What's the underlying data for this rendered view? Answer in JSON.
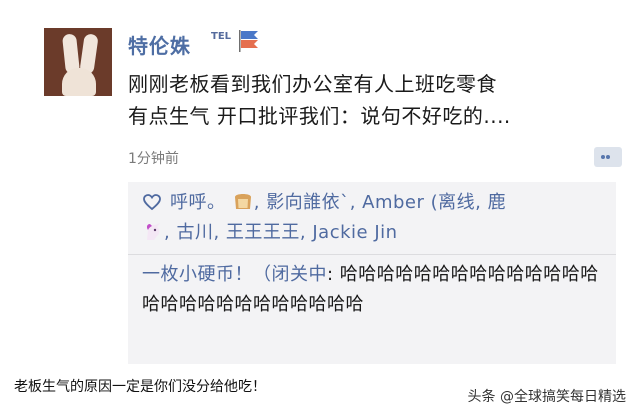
{
  "post": {
    "username": "特伦姝",
    "badge": "TEL",
    "text_line1": "刚刚老板看到我们办公室有人上班吃零食",
    "text_line2": "有点生气 开口批评我们：说句不好吃的....",
    "timestamp": "1分钟前"
  },
  "likes": {
    "names": [
      "呼呼。",
      "影向誰依`",
      "Amber (离线",
      "鹿",
      "古川",
      "王王王王",
      "Jackie Jin"
    ],
    "separator": ", "
  },
  "comment": {
    "author": "一枚小硬币！（闭关中",
    "colon": ": ",
    "text": "哈哈哈哈哈哈哈哈哈哈哈哈哈哈哈哈哈哈哈哈哈哈哈哈哈哈"
  },
  "caption": "老板生气的原因一定是你们没分给他吃！",
  "watermark": "头条 @全球搞笑每日精选"
}
